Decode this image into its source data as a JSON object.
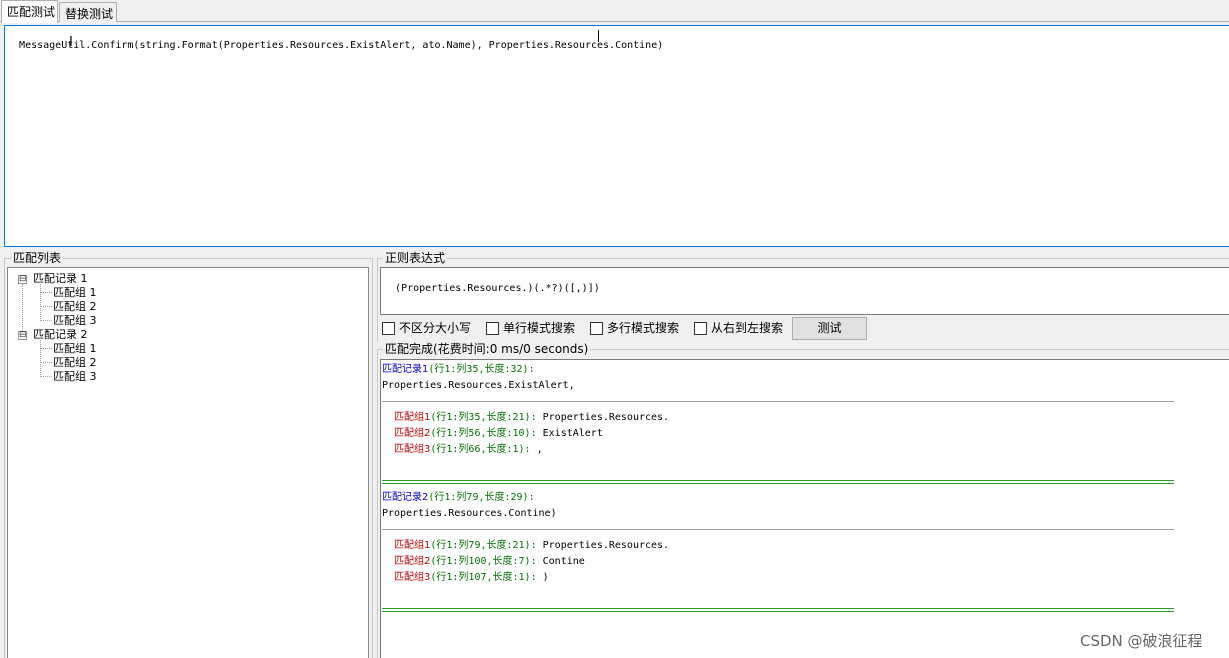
{
  "tabs": [
    {
      "label": "匹配测试",
      "active": true
    },
    {
      "label": "替换测试",
      "active": false
    }
  ],
  "input_text": "MessageUtil.Confirm(string.Format(Properties.Resources.ExistAlert, ato.Name), Properties.Resources.Contine)",
  "match_list": {
    "legend": "匹配列表",
    "toggle_symbol": "⊟",
    "records": [
      {
        "label": "匹配记录 1",
        "groups": [
          "匹配组 1",
          "匹配组 2",
          "匹配组 3"
        ]
      },
      {
        "label": "匹配记录 2",
        "groups": [
          "匹配组 1",
          "匹配组 2",
          "匹配组 3"
        ]
      }
    ]
  },
  "regex": {
    "legend": "正则表达式",
    "value": "(Properties.Resources.)(.*?)([,)])"
  },
  "options": {
    "ignore_case": {
      "label": "不区分大小写",
      "checked": false
    },
    "single_line": {
      "label": "单行模式搜索",
      "checked": false
    },
    "multi_line": {
      "label": "多行模式搜索",
      "checked": false
    },
    "right_to_left": {
      "label": "从右到左搜索",
      "checked": false
    },
    "test_button": "测试"
  },
  "results": {
    "legend": "匹配完成(花费时间:0 ms/0 seconds)",
    "records": [
      {
        "title": "匹配记录1",
        "meta": "(行1:列35,长度:32):",
        "text": "Properties.Resources.ExistAlert,",
        "groups": [
          {
            "title": "匹配组1",
            "meta": "(行1:列35,长度:21):",
            "value": "Properties.Resources."
          },
          {
            "title": "匹配组2",
            "meta": "(行1:列56,长度:10):",
            "value": "ExistAlert"
          },
          {
            "title": "匹配组3",
            "meta": "(行1:列66,长度:1):",
            "value": ","
          }
        ]
      },
      {
        "title": "匹配记录2",
        "meta": "(行1:列79,长度:29):",
        "text": "Properties.Resources.Contine)",
        "groups": [
          {
            "title": "匹配组1",
            "meta": "(行1:列79,长度:21):",
            "value": "Properties.Resources."
          },
          {
            "title": "匹配组2",
            "meta": "(行1:列100,长度:7):",
            "value": "Contine"
          },
          {
            "title": "匹配组3",
            "meta": "(行1:列107,长度:1):",
            "value": ")"
          }
        ]
      }
    ]
  },
  "watermark": "CSDN @破浪征程"
}
